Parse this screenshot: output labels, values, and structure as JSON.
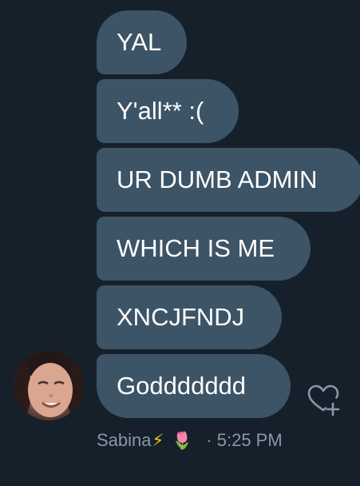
{
  "messages": [
    {
      "text": "YAL"
    },
    {
      "text": "Y'all** :("
    },
    {
      "text": "UR DUMB ADMIN"
    },
    {
      "text": "WHICH IS ME"
    },
    {
      "text": "XNCJFNDJ"
    },
    {
      "text": "Goddddddd"
    }
  ],
  "sender": {
    "name": "Sabina",
    "emoji_1": "⚡",
    "emoji_2": "🌷",
    "separator": "·",
    "time": "5:25 PM"
  },
  "icons": {
    "avatar": "profile-photo",
    "react": "heart-plus-icon"
  },
  "colors": {
    "background": "#15202b",
    "bubble": "#3d5466",
    "bubble_text": "#ffffff",
    "meta_text": "#8899a6"
  }
}
